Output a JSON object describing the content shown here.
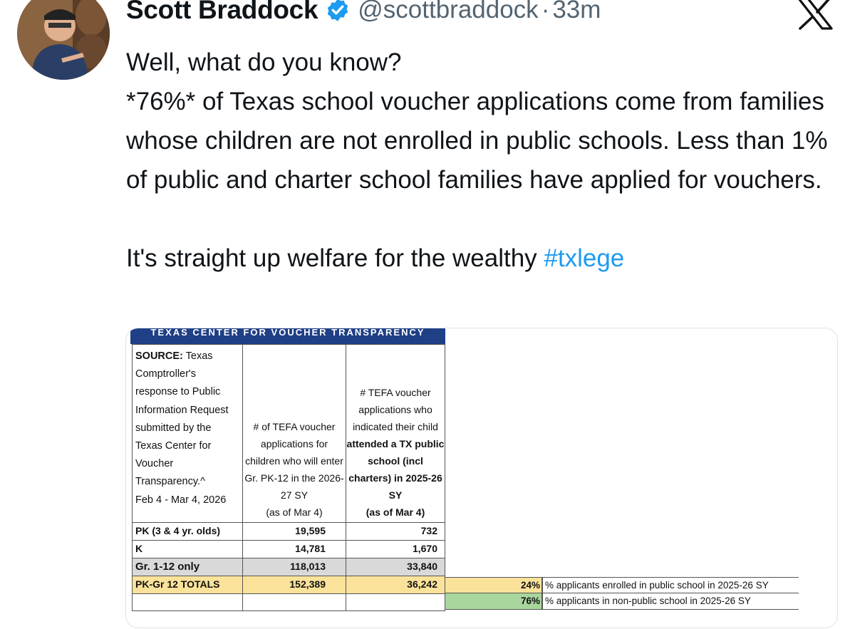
{
  "author": {
    "name": "Scott Braddock",
    "handle": "@scottbraddock",
    "separator": "·",
    "time": "33m"
  },
  "icons": {
    "verified": "verified-badge-icon",
    "platform": "x-logo-icon",
    "accent_color": "#1d9bf0"
  },
  "tweet": {
    "line1": "Well, what do you know?",
    "line2": "*76%* of Texas school voucher applications come from families whose children are not enrolled in public schools. Less than 1% of public and charter school families have applied for vouchers.",
    "line3_text": "It's straight up welfare for the wealthy ",
    "hashtag": "#txlege"
  },
  "table": {
    "banner": "TEXAS CENTER FOR VOUCHER TRANSPARENCY",
    "source_label": "SOURCE:",
    "source_text": " Texas Comptroller's response to Public Information Request submitted by the Texas Center for Voucher Transparency.^",
    "source_date": "Feb 4 - Mar 4, 2026",
    "col1_header": "# of TEFA voucher applications for children who will enter Gr. PK-12 in the 2026-27 SY",
    "col1_asof": "(as of Mar 4)",
    "col2_header_a": "# TEFA voucher applications who indicated their child ",
    "col2_header_bold": "attended a TX public school (incl charters) in 2025-26 SY",
    "col2_asof": "(as of Mar 4)",
    "rows": [
      {
        "label": "PK (3 & 4 yr. olds)",
        "v1": "19,595",
        "v2": "732"
      },
      {
        "label": "K",
        "v1": "14,781",
        "v2": "1,670"
      },
      {
        "label": "Gr. 1-12 only",
        "v1": "118,013",
        "v2": "33,840"
      },
      {
        "label": "PK-Gr 12 TOTALS",
        "v1": "152,389",
        "v2": "36,242"
      }
    ],
    "pct_rows": [
      {
        "pct": "24%",
        "label": "% applicants enrolled in public school in 2025-26 SY"
      },
      {
        "pct": "76%",
        "label": "% applicants in non-public school in 2025-26 SY"
      }
    ]
  }
}
